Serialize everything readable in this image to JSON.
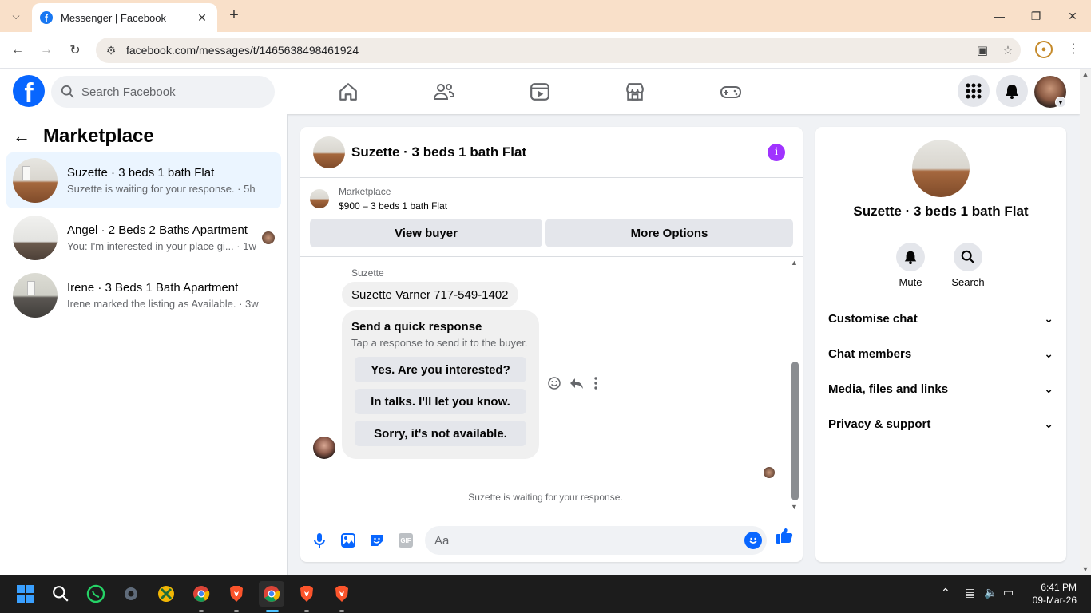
{
  "browser": {
    "tab_title": "Messenger | Facebook",
    "url": "facebook.com/messages/t/1465638498461924"
  },
  "fb": {
    "search_placeholder": "Search Facebook",
    "nav_icons": [
      "home-icon",
      "friends-icon",
      "video-icon",
      "marketplace-icon",
      "gaming-icon"
    ],
    "brand_color": "#0866ff"
  },
  "sidebar": {
    "title": "Marketplace",
    "conversations": [
      {
        "name": "Suzette · 3 beds 1 bath Flat",
        "preview": "Suzette is waiting for your response. · 5h"
      },
      {
        "name": "Angel · 2 Beds 2 Baths Apartment",
        "preview": "You: I'm interested in your place gi... · 1w"
      },
      {
        "name": "Irene · 3 Beds 1 Bath Apartment",
        "preview": "Irene marked the listing as Available. · 3w"
      }
    ]
  },
  "chat": {
    "title": "Suzette · 3 beds 1 bath Flat",
    "listing_label": "Marketplace",
    "listing_detail": "$900 – 3 beds 1 bath Flat",
    "view_buyer": "View buyer",
    "more_options": "More Options",
    "sender": "Suzette",
    "message": "Suzette Varner 717-549-1402",
    "quick_title": "Send a quick response",
    "quick_sub": "Tap a response to send it to the buyer.",
    "quick_replies": [
      "Yes. Are you interested?",
      "In talks. I'll let you know.",
      "Sorry, it's not available."
    ],
    "status": "Suzette is waiting for your response.",
    "composer_placeholder": "Aa",
    "gif_label": "GIF"
  },
  "details": {
    "name": "Suzette · 3 beds 1 bath Flat",
    "mute": "Mute",
    "search": "Search",
    "sections": [
      "Customise chat",
      "Chat members",
      "Media, files and links",
      "Privacy & support"
    ]
  },
  "taskbar": {
    "time": "6:41 PM",
    "date": "09-Mar-26"
  },
  "colors": {
    "accent_purple": "#a033ff",
    "active_conv_bg": "#ebf5ff"
  }
}
